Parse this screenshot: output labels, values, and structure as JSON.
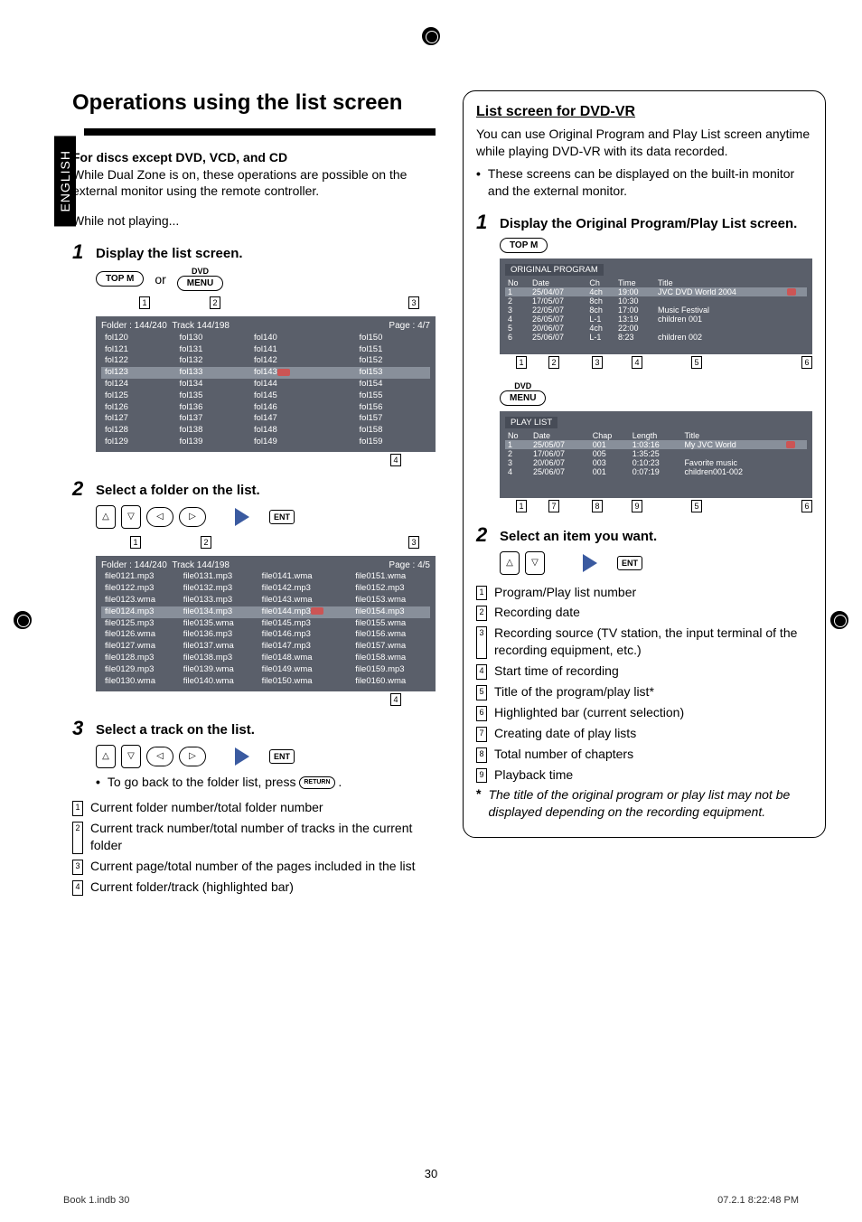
{
  "lang_tab": "ENGLISH",
  "left": {
    "title": "Operations using the list screen",
    "subhead": "For discs except DVD, VCD, and CD",
    "intro": "While Dual Zone is on, these operations are possible on the external monitor using the remote controller.",
    "while_not": "While not playing...",
    "step1": "Display the list screen.",
    "topm": "TOP M",
    "or": "or",
    "dvd": "DVD",
    "menu": "MENU",
    "screen1": {
      "folder": "Folder : 144/240",
      "track": "Track 144/198",
      "page": "Page : 4/7",
      "cols": [
        [
          "fol120",
          "fol121",
          "fol122",
          "fol123",
          "fol124",
          "fol125",
          "fol126",
          "fol127",
          "fol128",
          "fol129"
        ],
        [
          "fol130",
          "fol131",
          "fol132",
          "fol133",
          "fol134",
          "fol135",
          "fol136",
          "fol137",
          "fol138",
          "fol139"
        ],
        [
          "fol140",
          "fol141",
          "fol142",
          "fol143",
          "fol144",
          "fol145",
          "fol146",
          "fol147",
          "fol148",
          "fol149"
        ],
        [
          "fol150",
          "fol151",
          "fol152",
          "fol153",
          "fol154",
          "fol155",
          "fol156",
          "fol157",
          "fol158",
          "fol159"
        ]
      ],
      "hl_row": 3,
      "callouts": [
        "1",
        "2",
        "3",
        "4"
      ]
    },
    "step2": "Select a folder on the list.",
    "screen2": {
      "folder": "Folder : 144/240",
      "track": "Track 144/198",
      "page": "Page : 4/5",
      "cols": [
        [
          "file0121.mp3",
          "file0122.mp3",
          "file0123.wma",
          "file0124.mp3",
          "file0125.mp3",
          "file0126.wma",
          "file0127.wma",
          "file0128.mp3",
          "file0129.mp3",
          "file0130.wma"
        ],
        [
          "file0131.mp3",
          "file0132.mp3",
          "file0133.mp3",
          "file0134.mp3",
          "file0135.wma",
          "file0136.mp3",
          "file0137.wma",
          "file0138.mp3",
          "file0139.wma",
          "file0140.wma"
        ],
        [
          "file0141.wma",
          "file0142.mp3",
          "file0143.wma",
          "file0144.mp3",
          "file0145.mp3",
          "file0146.mp3",
          "file0147.mp3",
          "file0148.wma",
          "file0149.wma",
          "file0150.wma"
        ],
        [
          "file0151.wma",
          "file0152.mp3",
          "file0153.wma",
          "file0154.mp3",
          "file0155.wma",
          "file0156.wma",
          "file0157.wma",
          "file0158.wma",
          "file0159.mp3",
          "file0160.wma"
        ]
      ],
      "hl_row": 3,
      "callouts": [
        "1",
        "2",
        "3",
        "4"
      ]
    },
    "step3": "Select a track on the list.",
    "go_back": "To go back to the folder list, press ",
    "return": "RETURN",
    "legend": {
      "1": "Current folder number/total folder number",
      "2": "Current track number/total number of tracks in the current folder",
      "3": "Current page/total number of the pages included in the list",
      "4": "Current folder/track (highlighted bar)"
    },
    "ent": "ENT"
  },
  "right": {
    "heading": "List screen for DVD-VR",
    "intro": "You can use Original Program and Play List screen anytime while playing DVD-VR with its data recorded.",
    "bullet": "These screens can be displayed on the built-in monitor and the external monitor.",
    "step1": "Display the Original Program/Play List screen.",
    "topm": "TOP M",
    "orig": {
      "title": "ORIGINAL PROGRAM",
      "headers": [
        "No",
        "Date",
        "Ch",
        "Time",
        "Title"
      ],
      "rows": [
        [
          "1",
          "25/04/07",
          "4ch",
          "19:00",
          "JVC DVD World 2004"
        ],
        [
          "2",
          "17/05/07",
          "8ch",
          "10:30",
          ""
        ],
        [
          "3",
          "22/05/07",
          "8ch",
          "17:00",
          "Music Festival"
        ],
        [
          "4",
          "26/05/07",
          "L-1",
          "13:19",
          "children 001"
        ],
        [
          "5",
          "20/06/07",
          "4ch",
          "22:00",
          ""
        ],
        [
          "6",
          "25/06/07",
          "L-1",
          "8:23",
          "children 002"
        ]
      ],
      "callouts": [
        "1",
        "2",
        "3",
        "4",
        "5",
        "6"
      ]
    },
    "dvd": "DVD",
    "menu": "MENU",
    "play": {
      "title": "PLAY LIST",
      "headers": [
        "No",
        "Date",
        "Chap",
        "Length",
        "Title"
      ],
      "rows": [
        [
          "1",
          "25/05/07",
          "001",
          "1:03:16",
          "My JVC World"
        ],
        [
          "2",
          "17/06/07",
          "005",
          "1:35:25",
          ""
        ],
        [
          "3",
          "20/06/07",
          "003",
          "0:10:23",
          "Favorite music"
        ],
        [
          "4",
          "25/06/07",
          "001",
          "0:07:19",
          "children001-002"
        ]
      ],
      "callouts": [
        "1",
        "7",
        "8",
        "9",
        "5",
        "6"
      ]
    },
    "step2": "Select an item you want.",
    "ent": "ENT",
    "legend": {
      "1": "Program/Play list number",
      "2": "Recording date",
      "3": "Recording source (TV station, the input terminal of the recording equipment, etc.)",
      "4": "Start time of recording",
      "5": "Title of the program/play list*",
      "6": "Highlighted bar (current selection)",
      "7": "Creating date of play lists",
      "8": "Total number of chapters",
      "9": "Playback time"
    },
    "note": "The title of the original program or play list may not be displayed depending on the recording equipment."
  },
  "page_num": "30",
  "footer_left": "Book 1.indb   30",
  "footer_right": "07.2.1   8:22:48 PM"
}
